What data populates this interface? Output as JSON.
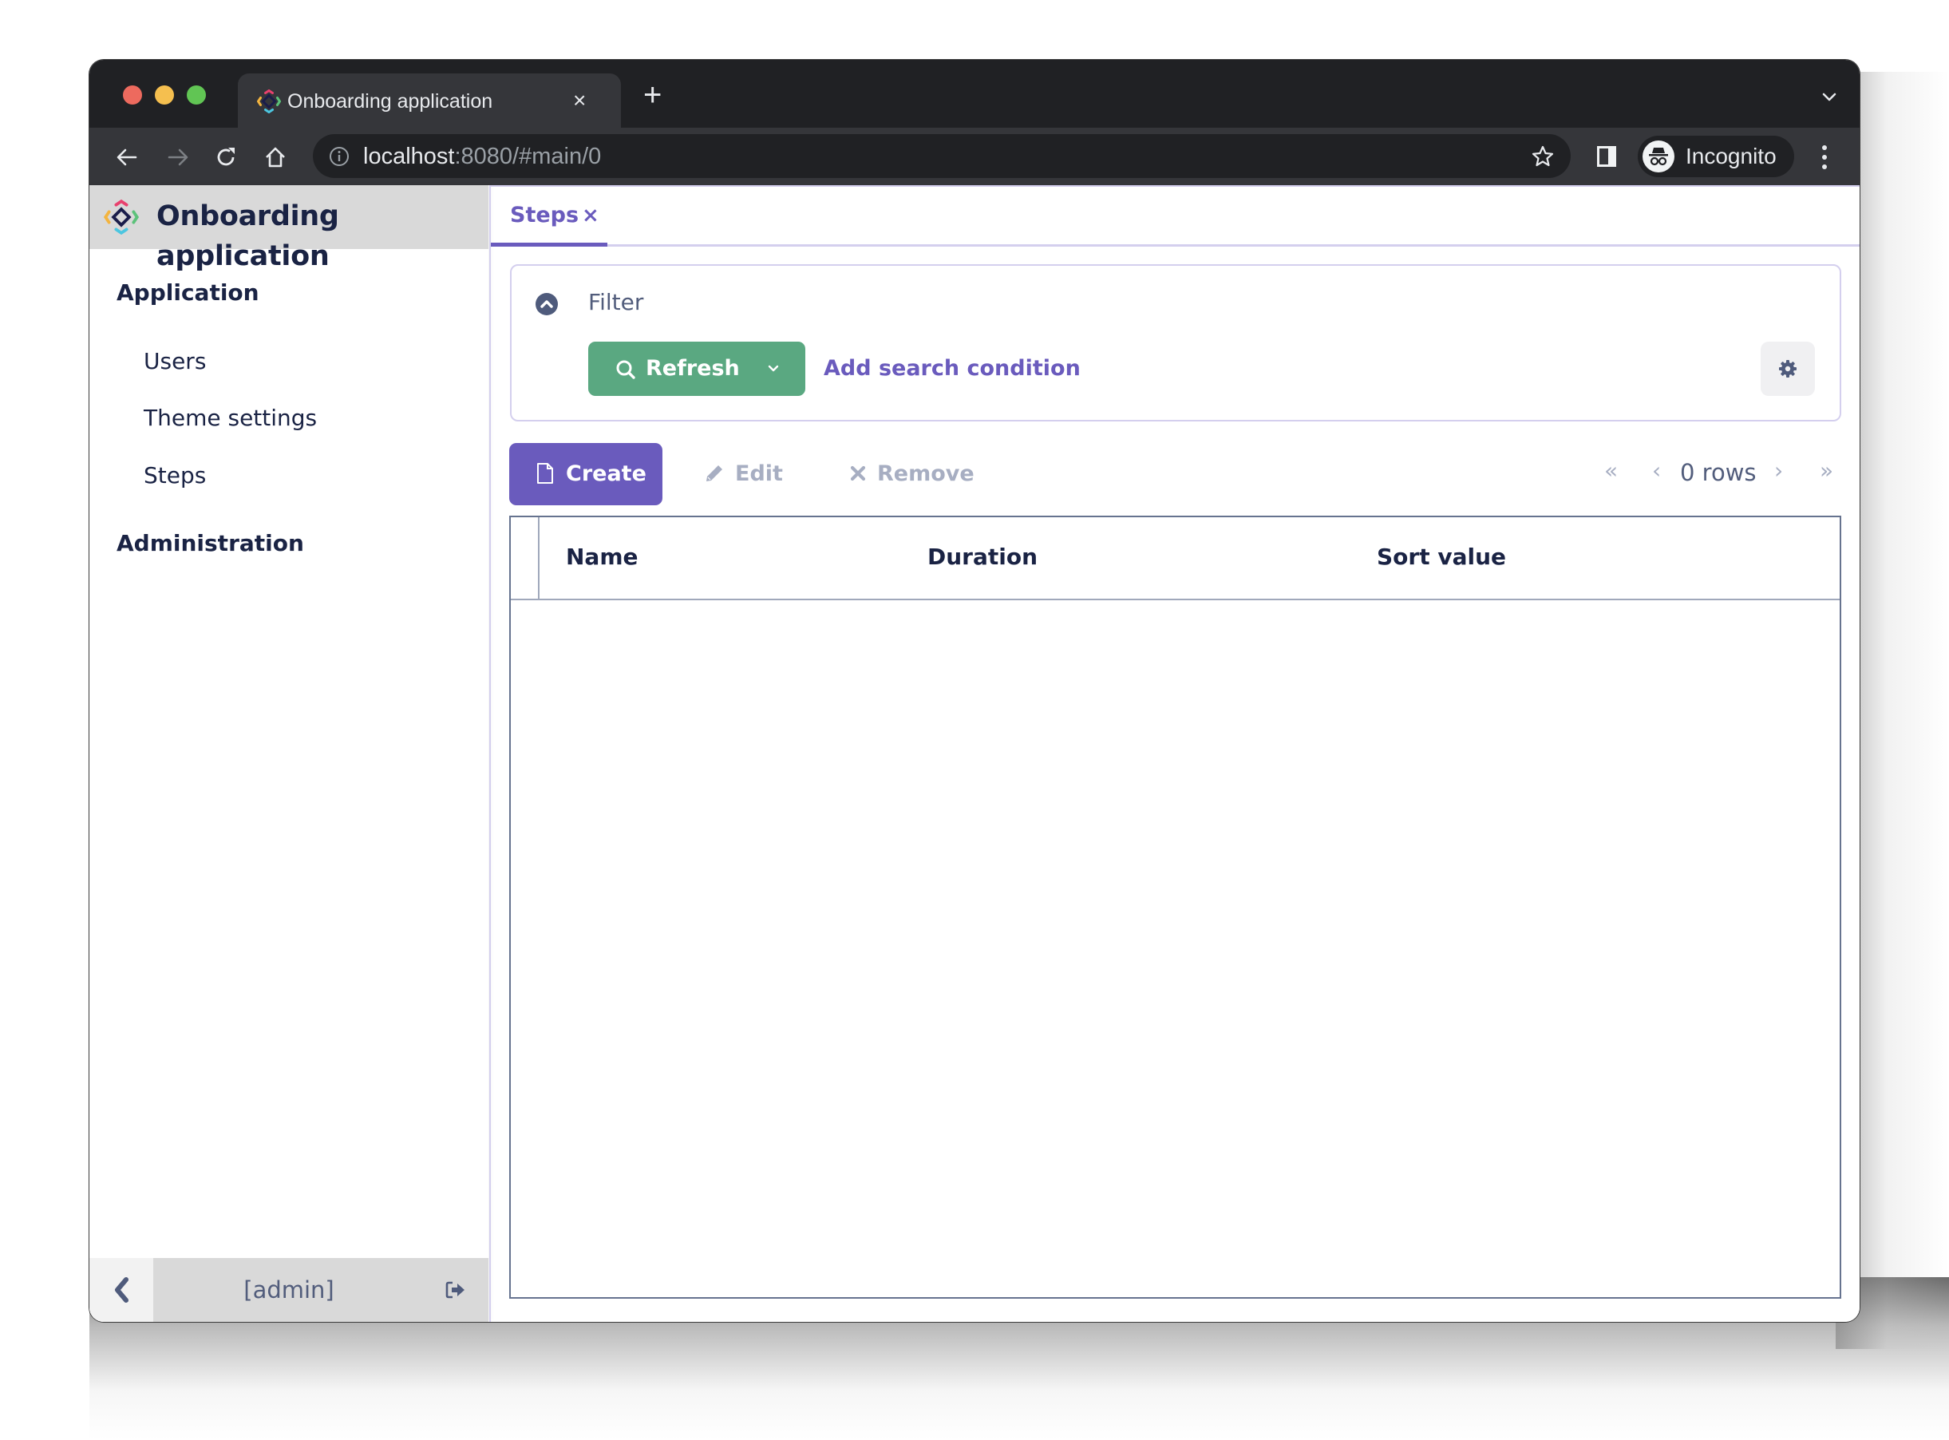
{
  "browser": {
    "tab_title": "Onboarding application",
    "tab_close": "×",
    "new_tab": "+",
    "url_host": "localhost",
    "url_rest": ":8080/#main/0",
    "profile_label": "Incognito"
  },
  "app": {
    "title": "Onboarding application",
    "brand_colors": {
      "accent": "#6a5bbd",
      "refresh_green": "#5aa881",
      "text_dark": "#1a2344",
      "text_muted": "#525d7c",
      "disabled": "#a7aec2"
    }
  },
  "sidebar": {
    "groups": [
      {
        "label": "Application",
        "items": [
          {
            "label": "Users"
          },
          {
            "label": "Theme settings"
          },
          {
            "label": "Steps"
          }
        ]
      },
      {
        "label": "Administration",
        "items": []
      }
    ],
    "footer": {
      "username": "[admin]"
    }
  },
  "main": {
    "tabs": [
      {
        "label": "Steps",
        "close": "×",
        "active": true
      }
    ],
    "filter": {
      "label": "Filter",
      "refresh_label": "Refresh",
      "add_condition_label": "Add search condition"
    },
    "actions": {
      "create_label": "Create",
      "edit_label": "Edit",
      "remove_label": "Remove"
    },
    "pagination": {
      "first": "«",
      "prev": "‹",
      "rows_label": "0 rows",
      "next": "›",
      "last": "»"
    },
    "table": {
      "columns": [
        "Name",
        "Duration",
        "Sort value"
      ],
      "rows": []
    }
  }
}
